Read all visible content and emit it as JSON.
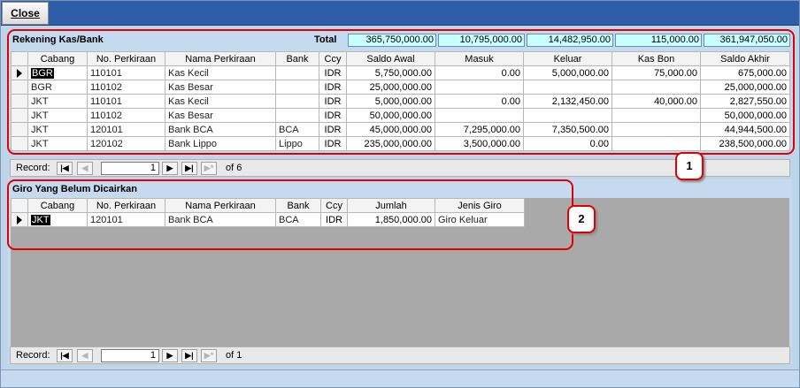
{
  "toolbar": {
    "close_label": "Close"
  },
  "panel1": {
    "title": "Rekening Kas/Bank",
    "total_label": "Total",
    "totals": [
      "365,750,000.00",
      "10,795,000.00",
      "14,482,950.00",
      "115,000.00",
      "361,947,050.00"
    ],
    "columns": [
      "Cabang",
      "No. Perkiraan",
      "Nama Perkiraan",
      "Bank",
      "Ccy",
      "Saldo Awal",
      "Masuk",
      "Keluar",
      "Kas Bon",
      "Saldo Akhir"
    ],
    "rows": [
      [
        "BGR",
        "110101",
        "Kas Kecil",
        "",
        "IDR",
        "5,750,000.00",
        "0.00",
        "5,000,000.00",
        "75,000.00",
        "675,000.00"
      ],
      [
        "BGR",
        "110102",
        "Kas Besar",
        "",
        "IDR",
        "25,000,000.00",
        "",
        "",
        "",
        "25,000,000.00"
      ],
      [
        "JKT",
        "110101",
        "Kas Kecil",
        "",
        "IDR",
        "5,000,000.00",
        "0.00",
        "2,132,450.00",
        "40,000.00",
        "2,827,550.00"
      ],
      [
        "JKT",
        "110102",
        "Kas Besar",
        "",
        "IDR",
        "50,000,000.00",
        "",
        "",
        "",
        "50,000,000.00"
      ],
      [
        "JKT",
        "120101",
        "Bank BCA",
        "BCA",
        "IDR",
        "45,000,000.00",
        "7,295,000.00",
        "7,350,500.00",
        "",
        "44,944,500.00"
      ],
      [
        "JKT",
        "120102",
        "Bank Lippo",
        "Lippo",
        "IDR",
        "235,000,000.00",
        "3,500,000.00",
        "0.00",
        "",
        "238,500,000.00"
      ]
    ],
    "nav": {
      "label": "Record:",
      "current": "1",
      "of_label": "of 6"
    }
  },
  "panel2": {
    "title": "Giro Yang Belum Dicairkan",
    "columns": [
      "Cabang",
      "No. Perkiraan",
      "Nama Perkiraan",
      "Bank",
      "Ccy",
      "Jumlah",
      "Jenis Giro"
    ],
    "rows": [
      [
        "JKT",
        "120101",
        "Bank BCA",
        "BCA",
        "IDR",
        "1,850,000.00",
        "Giro Keluar"
      ]
    ],
    "nav": {
      "label": "Record:",
      "current": "1",
      "of_label": "of 1"
    }
  },
  "callouts": [
    "1",
    "2"
  ],
  "colors": {
    "toolbar": "#2e5ea8",
    "panel": "#c5d9ef",
    "totals_bg": "#c8ffff",
    "callout": "#e00000"
  }
}
